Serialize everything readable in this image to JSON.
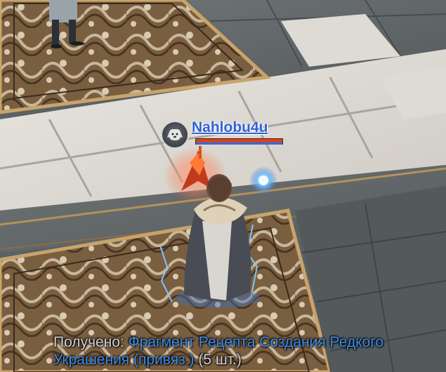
{
  "player": {
    "name": "Nahlobu4u",
    "hp_fraction": 1.0,
    "mp_fraction": 1.0,
    "pet_icon": "dog-icon"
  },
  "loot_message": {
    "label": "Получено:",
    "item": "Фрагмент Рецепта Создания Редкого Украшения (привяз.)",
    "count": "(5 шт.)"
  },
  "colors": {
    "player_name": "#2f63d6",
    "hp": "#d9421f",
    "mp": "#2e6fd8",
    "loot_item": "#3d8de6",
    "loot_label": "#d0d0d0"
  }
}
